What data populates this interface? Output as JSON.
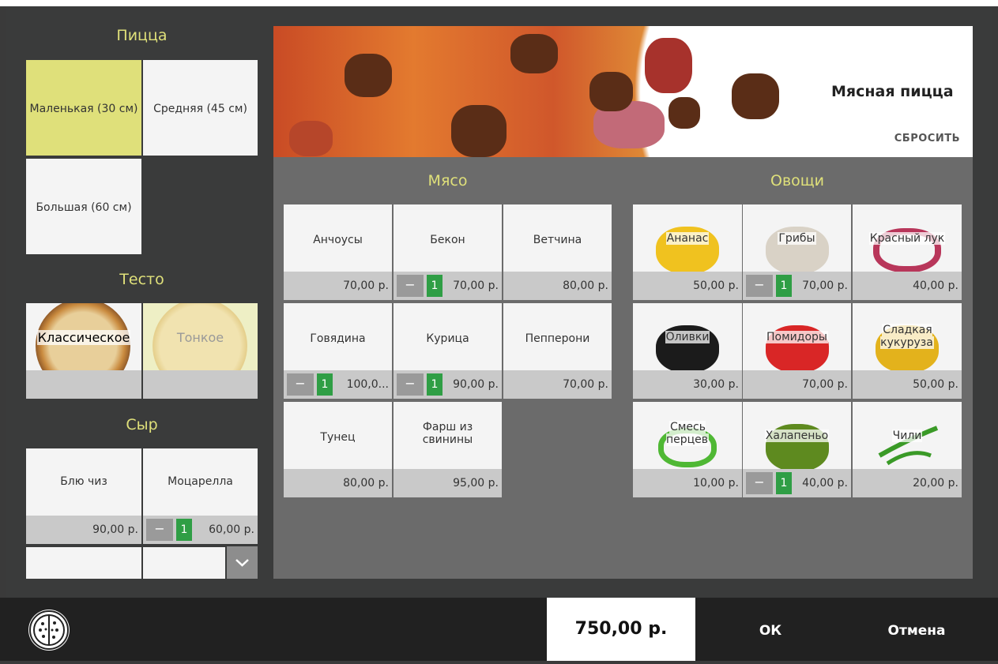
{
  "pizza": {
    "title": "Пицца",
    "sizes": [
      {
        "label": "Маленькая (30 см)",
        "selected": true
      },
      {
        "label": "Средняя (45 см)",
        "selected": false
      },
      {
        "label": "Большая (60 см)",
        "selected": false
      }
    ]
  },
  "dough": {
    "title": "Тесто",
    "items": [
      {
        "label": "Классическое",
        "selected": false
      },
      {
        "label": "Тонкое",
        "selected": true
      }
    ]
  },
  "cheese": {
    "title": "Сыр",
    "items": [
      {
        "label": "Блю чиз",
        "price": "90,00 р."
      },
      {
        "label": "Моцарелла",
        "price": "60,00 р.",
        "qty": "1",
        "minus": "−"
      }
    ],
    "more_icon": "chevron-down-icon"
  },
  "banner": {
    "title": "Мясная пицца",
    "reset": "СБРОСИТЬ"
  },
  "meat": {
    "title": "Мясо",
    "items": [
      {
        "label": "Анчоусы",
        "price": "70,00 р."
      },
      {
        "label": "Бекон",
        "price": "70,00 р.",
        "qty": "1",
        "minus": "−"
      },
      {
        "label": "Ветчина",
        "price": "80,00 р."
      },
      {
        "label": "Говядина",
        "price": "100,0...",
        "qty": "1",
        "minus": "−"
      },
      {
        "label": "Курица",
        "price": "90,00 р.",
        "qty": "1",
        "minus": "−"
      },
      {
        "label": "Пепперони",
        "price": "70,00 р."
      },
      {
        "label": "Тунец",
        "price": "80,00 р."
      },
      {
        "label": "Фарш из свинины",
        "price": "95,00 р."
      }
    ]
  },
  "veg": {
    "title": "Овощи",
    "items": [
      {
        "label": "Ананас",
        "price": "50,00 р.",
        "color": "#f0c21f"
      },
      {
        "label": "Грибы",
        "price": "70,00 р.",
        "qty": "1",
        "minus": "−",
        "color": "#d9d2c6"
      },
      {
        "label": "Красный лук",
        "price": "40,00 р.",
        "color": "#b8365a"
      },
      {
        "label": "Оливки",
        "price": "30,00 р.",
        "color": "#1b1b1b"
      },
      {
        "label": "Помидоры",
        "price": "70,00 р.",
        "color": "#d92626"
      },
      {
        "label": "Сладкая кукуруза",
        "price": "50,00 р.",
        "color": "#e3b21c"
      },
      {
        "label": "Смесь перцев",
        "price": "10,00 р.",
        "color": "#4fb834"
      },
      {
        "label": "Халапеньо",
        "price": "40,00 р.",
        "qty": "1",
        "minus": "−",
        "color": "#5e8a1f"
      },
      {
        "label": "Чили",
        "price": "20,00 р.",
        "color": "#3a9a27"
      }
    ]
  },
  "footer": {
    "total": "750,00 р.",
    "ok": "ОК",
    "cancel": "Отмена"
  },
  "colors": {
    "accent": "#dfe07a",
    "qty_badge": "#2f9e45"
  }
}
